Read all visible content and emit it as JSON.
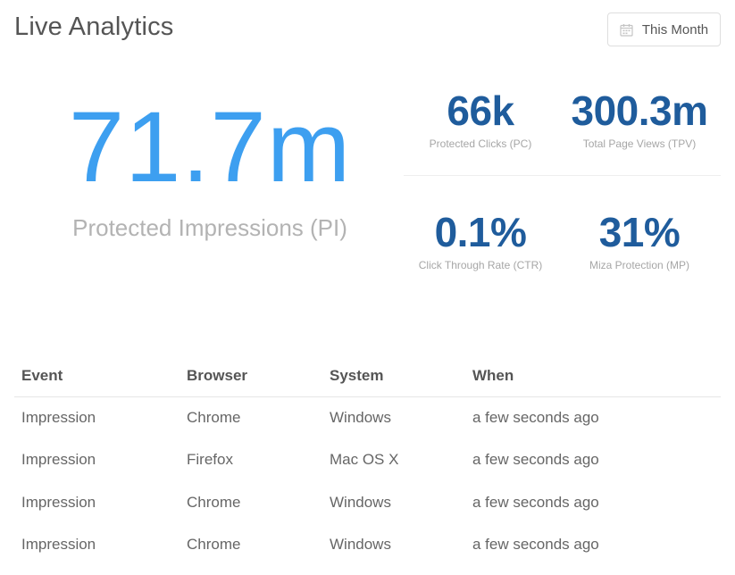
{
  "header": {
    "title": "Live Analytics",
    "range_button": {
      "label": "This Month",
      "icon": "calendar-icon"
    }
  },
  "primary_metric": {
    "value": "71.7m",
    "label": "Protected Impressions (PI)",
    "color": "#3d9ff0"
  },
  "stats": [
    {
      "value": "66k",
      "label": "Protected Clicks (PC)"
    },
    {
      "value": "300.3m",
      "label": "Total Page Views (TPV)"
    },
    {
      "value": "0.1%",
      "label": "Click Through Rate (CTR)"
    },
    {
      "value": "31%",
      "label": "Miza Protection (MP)"
    }
  ],
  "stats_color": "#1f5c9c",
  "events_table": {
    "columns": [
      "Event",
      "Browser",
      "System",
      "When"
    ],
    "rows": [
      [
        "Impression",
        "Chrome",
        "Windows",
        "a few seconds ago"
      ],
      [
        "Impression",
        "Firefox",
        "Mac OS X",
        "a few seconds ago"
      ],
      [
        "Impression",
        "Chrome",
        "Windows",
        "a few seconds ago"
      ],
      [
        "Impression",
        "Chrome",
        "Windows",
        "a few seconds ago"
      ]
    ]
  }
}
